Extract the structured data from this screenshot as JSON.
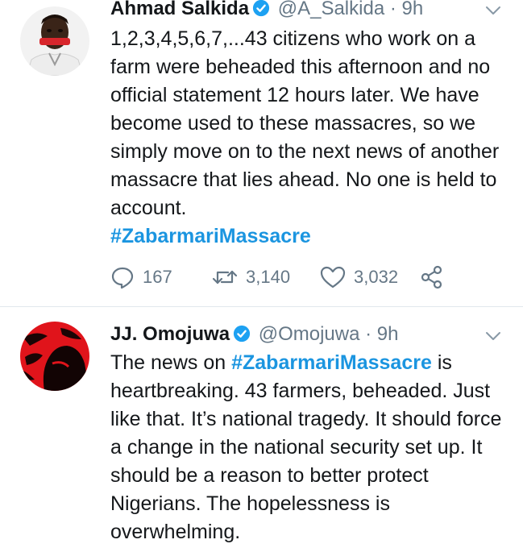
{
  "tweets": [
    {
      "name": "Ahmad Salkida",
      "handle": "@A_Salkida",
      "separator": "·",
      "time": "9h",
      "text": "1,2,3,4,5,6,7,...43 citizens who work on a farm were beheaded this afternoon and no official statement 12 hours later. We have become used to these massacres, so we simply move on to the next news of another massacre that lies ahead. No one is held to account.",
      "hashtag": "#ZabarmariMassacre",
      "replies": "167",
      "retweets": "3,140",
      "likes": "3,032"
    },
    {
      "name": "JJ. Omojuwa",
      "handle": "@Omojuwa",
      "separator": "·",
      "time": "9h",
      "text_before": "The news on ",
      "hashtag": "#ZabarmariMassacre",
      "text_after": " is heartbreaking. 43 farmers, beheaded. Just like that. It’s national tragedy. It should force a change in the national security set up. It should be a reason to better protect Nigerians. The hopelessness is overwhelming."
    }
  ],
  "colors": {
    "link": "#1b95e0",
    "secondary": "#657786",
    "verified": "#1da1f2",
    "divider": "#e1e8ed"
  }
}
